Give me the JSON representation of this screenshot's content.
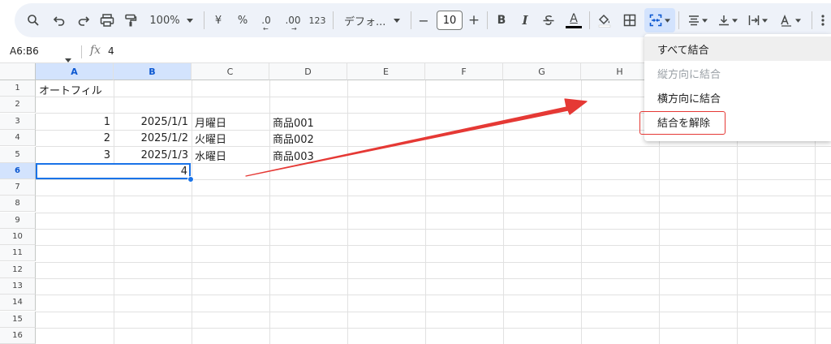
{
  "toolbar": {
    "zoom": "100%",
    "currency": "¥",
    "percent": "%",
    "dec_decrease": ".0",
    "dec_increase": ".00",
    "number_format": "123",
    "font_name": "デフォ...",
    "font_size": "10",
    "minus": "−",
    "plus": "+",
    "bold": "B",
    "italic": "I",
    "text_color_letter": "A"
  },
  "formula_bar": {
    "name_box": "A6:B6",
    "fx": "fx",
    "value": "4"
  },
  "columns": [
    "A",
    "B",
    "C",
    "D",
    "E",
    "F",
    "G",
    "H"
  ],
  "rows": [
    "1",
    "2",
    "3",
    "4",
    "5",
    "6",
    "7",
    "8",
    "9",
    "10",
    "11",
    "12",
    "13",
    "14",
    "15",
    "16"
  ],
  "cells": {
    "a1": "オートフィル",
    "a3": "1",
    "b3": "2025/1/1",
    "c3": "月曜日",
    "d3": "商品001",
    "a4": "2",
    "b4": "2025/1/2",
    "c4": "火曜日",
    "d4": "商品002",
    "a5": "3",
    "b5": "2025/1/3",
    "c5": "水曜日",
    "d5": "商品003",
    "a6": "4"
  },
  "merge_menu": {
    "items": [
      {
        "label": "すべて結合",
        "state": "hover"
      },
      {
        "label": "縦方向に結合",
        "state": "disabled"
      },
      {
        "label": "横方向に結合",
        "state": "normal"
      },
      {
        "label": "結合を解除",
        "state": "highlighted"
      }
    ]
  },
  "colors": {
    "accent": "#1a73e8",
    "selection_header": "#d3e3fd",
    "annotation_red": "#e53935",
    "toolbar_bg": "#eef2f9"
  }
}
